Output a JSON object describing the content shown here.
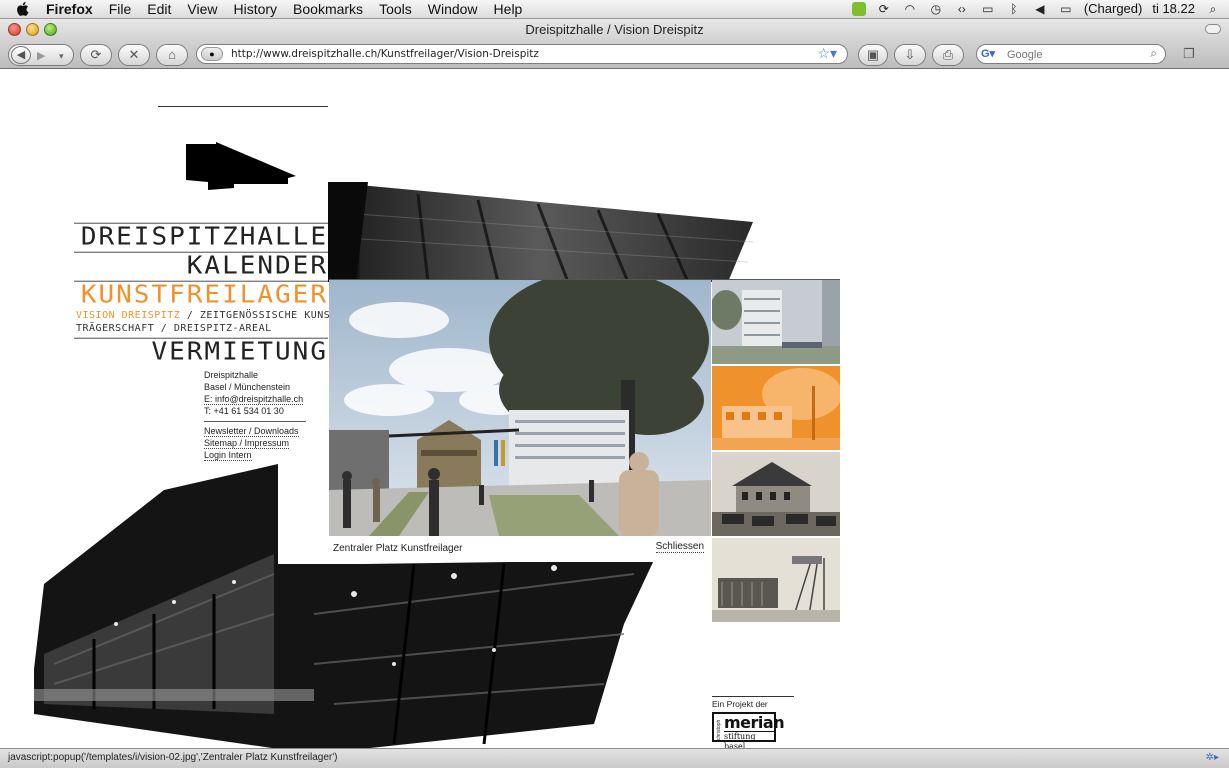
{
  "menubar": {
    "app": "Firefox",
    "items": [
      "File",
      "Edit",
      "View",
      "History",
      "Bookmarks",
      "Tools",
      "Window",
      "Help"
    ],
    "battery": "(Charged)",
    "clock": "ti 18.22"
  },
  "window": {
    "title": "Dreispitzhalle / Vision Dreispitz"
  },
  "toolbar": {
    "url": "http://www.dreispitzhalle.ch/Kunstfreilager/Vision-Dreispitz",
    "search_placeholder": "Google"
  },
  "nav": {
    "dreispitzhalle": "DREISPITZHALLE",
    "kalender": "KALENDER",
    "kunstfreilager": "KUNSTFREILAGER",
    "vision": "VISION DREISPITZ",
    "zeitgenoessisch": "ZEITGENÖSSISCHE KUNST",
    "traegerschaft": "TRÄGERSCHAFT",
    "areal": "DREISPITZ-AREAL",
    "vermietung": "VERMIETUNG"
  },
  "contact": {
    "name": "Dreispitzhalle",
    "place": "Basel / Münchenstein",
    "email": "E: info@dreispitzhalle.ch",
    "phone": "T: +41 61 534 01 30",
    "links": [
      "Newsletter / Downloads",
      "Sitemap / Impressum",
      "Login Intern"
    ]
  },
  "popup": {
    "caption": "Zentraler Platz Kunstfreilager",
    "close": "Schliessen"
  },
  "footer": {
    "project_label": "Ein Projekt der",
    "logo_name": "merian",
    "logo_sub": "stiftung basel",
    "logo_vert": "christoph"
  },
  "status": {
    "text": "javascript:popup('/templates/i/vision-02.jpg','Zentraler Platz Kunstfreilager')"
  },
  "colors": {
    "accent": "#f0922b"
  }
}
